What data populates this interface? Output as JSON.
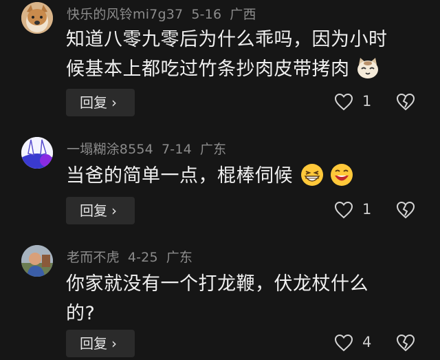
{
  "comments": [
    {
      "username": "快乐的风铃mi7g37",
      "date": "5-16",
      "location": "广西",
      "text_line1": "知道八零九零后为什么乖吗，因为小时",
      "text_line2": "候基本上都吃过竹条抄肉皮带拷肉",
      "text_emoji": "cat-face-emoji",
      "reply_label": "回复",
      "likes": "1"
    },
    {
      "username": "一塌糊涂8554",
      "date": "7-14",
      "location": "广东",
      "text_line1": "当爸的简单一点，棍棒伺候",
      "text_emoji": "grinning-squinting-face-emoji",
      "reply_label": "回复",
      "likes": "1"
    },
    {
      "username": "老而不虎",
      "date": "4-25",
      "location": "广东",
      "text_line1": "你家就没有一个打龙鞭，伏龙杖什么",
      "text_line2": "的?",
      "reply_label": "回复",
      "likes": "4"
    }
  ]
}
